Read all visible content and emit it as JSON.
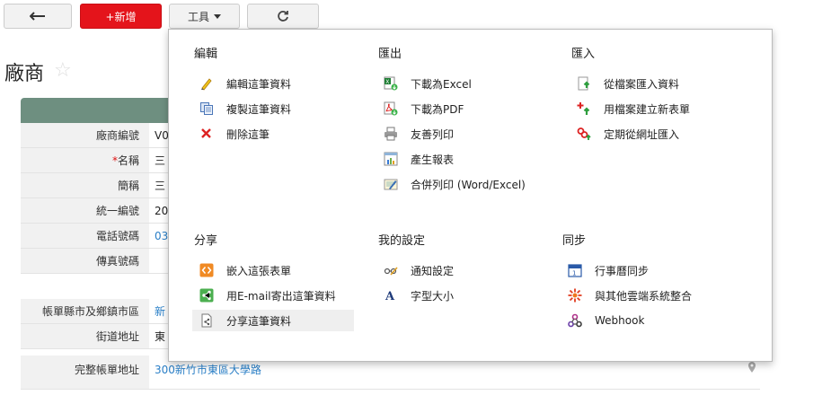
{
  "toolbar": {
    "new_label": "+新增",
    "tools_label": "工具"
  },
  "page": {
    "title": "廠商"
  },
  "record": {
    "rows": [
      {
        "label": "廠商編號",
        "value": "V0"
      },
      {
        "label": "名稱",
        "value": "三"
      },
      {
        "label": "簡稱",
        "value": "三"
      },
      {
        "label": "統一編號",
        "value": "20"
      },
      {
        "label": "電話號碼",
        "value": "03"
      },
      {
        "label": "傳真號碼",
        "value": ""
      }
    ],
    "address_rows": [
      {
        "label": "帳單縣市及鄉鎮市區",
        "value": "新"
      },
      {
        "label": "街道地址",
        "value": "東"
      },
      {
        "label": "完整帳單地址",
        "value": "300新竹市東區大學路"
      }
    ],
    "required_mark": "*"
  },
  "menu": {
    "edit": {
      "title": "編輯",
      "items": [
        {
          "label": "編輯這筆資料",
          "icon": "pencil-icon"
        },
        {
          "label": "複製這筆資料",
          "icon": "copy-icon"
        },
        {
          "label": "刪除這筆",
          "icon": "delete-icon"
        }
      ]
    },
    "export": {
      "title": "匯出",
      "items": [
        {
          "label": "下載為Excel",
          "icon": "excel-icon"
        },
        {
          "label": "下載為PDF",
          "icon": "pdf-icon"
        },
        {
          "label": "友善列印",
          "icon": "printer-icon"
        },
        {
          "label": "產生報表",
          "icon": "report-icon"
        },
        {
          "label": "合併列印 (Word/Excel)",
          "icon": "merge-print-icon"
        }
      ]
    },
    "import": {
      "title": "匯入",
      "items": [
        {
          "label": "從檔案匯入資料",
          "icon": "file-import-icon"
        },
        {
          "label": "用檔案建立新表單",
          "icon": "new-form-icon"
        },
        {
          "label": "定期從網址匯入",
          "icon": "url-import-icon"
        }
      ]
    },
    "share": {
      "title": "分享",
      "items": [
        {
          "label": "嵌入這張表單",
          "icon": "embed-icon"
        },
        {
          "label": "用E-mail寄出這筆資料",
          "icon": "share-icon"
        },
        {
          "label": "分享這筆資料",
          "icon": "share-record-icon"
        }
      ]
    },
    "settings": {
      "title": "我的設定",
      "items": [
        {
          "label": "通知設定",
          "icon": "notification-icon"
        },
        {
          "label": "字型大小",
          "icon": "font-size-icon"
        }
      ]
    },
    "sync": {
      "title": "同步",
      "items": [
        {
          "label": "行事曆同步",
          "icon": "calendar-icon"
        },
        {
          "label": "與其他雲端系統整合",
          "icon": "integration-icon"
        },
        {
          "label": "Webhook",
          "icon": "webhook-icon"
        }
      ]
    }
  },
  "colors": {
    "new_button": "#e4141b",
    "record_header": "#6e8f80",
    "link": "#2a7fc7"
  }
}
